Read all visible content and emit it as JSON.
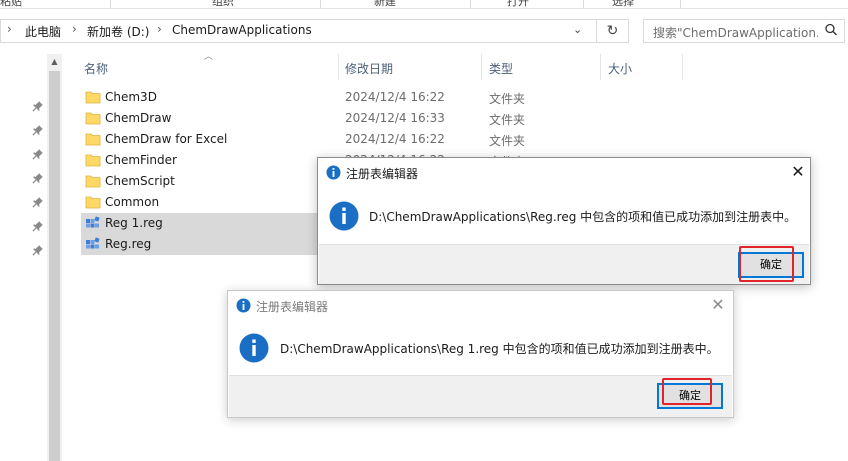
{
  "ribbon": {
    "labels": [
      "粘贴",
      "组织",
      "新建",
      "打开",
      "选择"
    ]
  },
  "address_bar": {
    "breadcrumbs": [
      "此电脑",
      "新加卷 (D:)",
      "ChemDrawApplications"
    ],
    "search_placeholder": "搜索\"ChemDrawApplication..."
  },
  "columns": {
    "name": "名称",
    "date": "修改日期",
    "type": "类型",
    "size": "大小"
  },
  "files": [
    {
      "name": "Chem3D",
      "date": "2024/12/4 16:22",
      "type": "文件夹",
      "kind": "folder",
      "selected": false
    },
    {
      "name": "ChemDraw",
      "date": "2024/12/4 16:33",
      "type": "文件夹",
      "kind": "folder",
      "selected": false
    },
    {
      "name": "ChemDraw for Excel",
      "date": "2024/12/4 16:22",
      "type": "文件夹",
      "kind": "folder",
      "selected": false
    },
    {
      "name": "ChemFinder",
      "date": "2024/12/4 16:22",
      "type": "文件夹",
      "kind": "folder",
      "selected": false
    },
    {
      "name": "ChemScript",
      "date": "",
      "type": "",
      "kind": "folder",
      "selected": false
    },
    {
      "name": "Common",
      "date": "",
      "type": "",
      "kind": "folder",
      "selected": false
    },
    {
      "name": "Reg 1.reg",
      "date": "",
      "type": "",
      "kind": "reg",
      "selected": true
    },
    {
      "name": "Reg.reg",
      "date": "",
      "type": "",
      "kind": "reg",
      "selected": true
    }
  ],
  "dialog_front": {
    "title": "注册表编辑器",
    "message": "D:\\ChemDrawApplications\\Reg.reg 中包含的项和值已成功添加到注册表中。",
    "ok_label": "确定"
  },
  "dialog_back": {
    "title": "注册表编辑器",
    "message": "D:\\ChemDrawApplications\\Reg 1.reg 中包含的项和值已成功添加到注册表中。",
    "ok_label": "确定"
  },
  "colors": {
    "accent": "#0078d7",
    "highlight": "#e0242b",
    "folder": "#ffd866",
    "selection": "#d9d9d9"
  }
}
